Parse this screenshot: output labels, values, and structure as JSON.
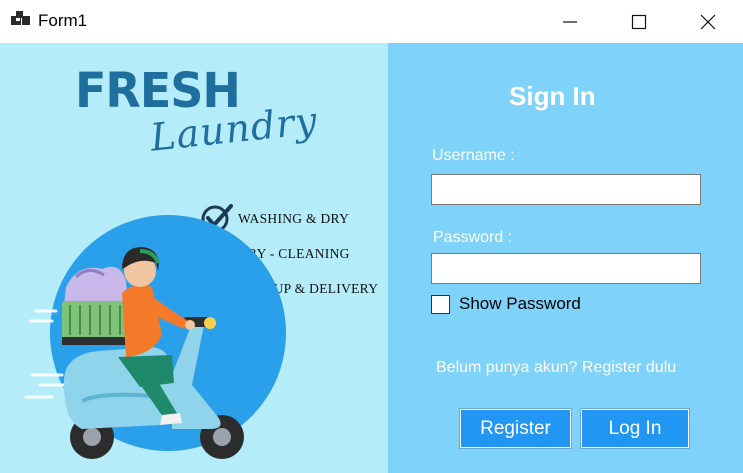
{
  "window": {
    "title": "Form1",
    "icon": "app-window-icon"
  },
  "promo": {
    "brand_main": "FRESH",
    "brand_script": "Laundry",
    "services": [
      {
        "label": "WASHING & DRY",
        "icon": "check-circle-icon"
      },
      {
        "label": "DRY - CLEANING",
        "icon": "check-circle-icon"
      },
      {
        "label": "PICK UP & DELIVERY",
        "icon": "check-circle-icon"
      }
    ]
  },
  "signin": {
    "title": "Sign In",
    "username_label": "Username :",
    "username_value": "",
    "password_label": "Password :",
    "password_value": "",
    "show_password_label": "Show Password",
    "show_password_checked": false,
    "register_prompt": "Belum punya akun? Register dulu",
    "register_button": "Register",
    "login_button": "Log In"
  },
  "colors": {
    "left_panel": "#b5ecfa",
    "right_panel": "#7fd2fa",
    "brand": "#1f6f9e",
    "button": "#2196f3",
    "circle": "#2aa0ea"
  }
}
